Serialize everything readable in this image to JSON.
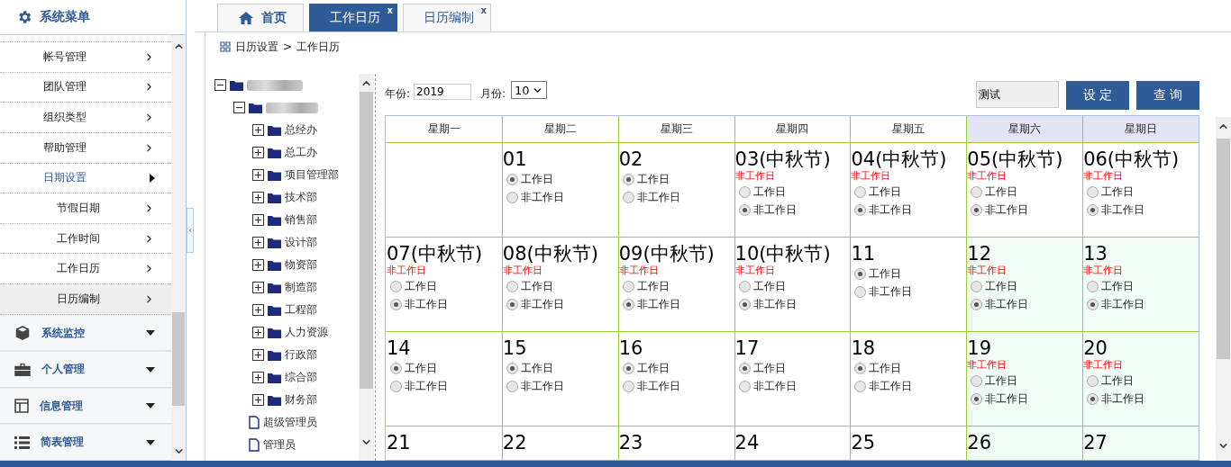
{
  "sidebar": {
    "title": "系统菜单",
    "items": [
      {
        "label": "帐号管理",
        "selected": false
      },
      {
        "label": "团队管理",
        "selected": false
      },
      {
        "label": "组织类型",
        "selected": false
      },
      {
        "label": "帮助管理",
        "selected": false
      },
      {
        "label": "日期设置",
        "selected": false,
        "expanded": true,
        "children": [
          {
            "label": "节假日期",
            "selected": false
          },
          {
            "label": "工作时间",
            "selected": false
          },
          {
            "label": "工作日历",
            "selected": false
          },
          {
            "label": "日历编制",
            "selected": true
          }
        ]
      }
    ],
    "groups": [
      {
        "label": "系统监控",
        "kind": "box",
        "expanded": false
      },
      {
        "label": "个人管理",
        "kind": "briefcase",
        "expanded": false
      },
      {
        "label": "信息管理",
        "kind": "layout",
        "expanded": false
      },
      {
        "label": "简表管理",
        "kind": "list",
        "expanded": false
      }
    ]
  },
  "tabs": [
    {
      "label": "首页",
      "kind": "home",
      "selected": false
    },
    {
      "label": "工作日历",
      "kind": "closable",
      "selected": true,
      "close": "x"
    },
    {
      "label": "日历编制",
      "kind": "closable",
      "selected": false,
      "close": "x"
    }
  ],
  "breadcrumb": {
    "items": [
      "日历设置",
      "工作日历"
    ],
    "separator": ">"
  },
  "tree": {
    "nodes": [
      {
        "kind": "folder",
        "expanded": true,
        "children": [
          {
            "kind": "folder",
            "expanded": true,
            "children": [
              {
                "kind": "folder",
                "label": "总经办",
                "expanded": false
              },
              {
                "kind": "folder",
                "label": "总工办",
                "expanded": false
              },
              {
                "kind": "folder",
                "label": "项目管理部",
                "expanded": false
              },
              {
                "kind": "folder",
                "label": "技术部",
                "expanded": false
              },
              {
                "kind": "folder",
                "label": "销售部",
                "expanded": false
              },
              {
                "kind": "folder",
                "label": "设计部",
                "expanded": false
              },
              {
                "kind": "folder",
                "label": "物资部",
                "expanded": false
              },
              {
                "kind": "folder",
                "label": "制造部",
                "expanded": false
              },
              {
                "kind": "folder",
                "label": "工程部",
                "expanded": false
              },
              {
                "kind": "folder",
                "label": "人力资源",
                "expanded": false
              },
              {
                "kind": "folder",
                "label": "行政部",
                "expanded": false
              },
              {
                "kind": "folder",
                "label": "综合部",
                "expanded": false
              },
              {
                "kind": "folder",
                "label": "财务部",
                "expanded": false
              }
            ]
          },
          {
            "kind": "file",
            "label": "超级管理员"
          },
          {
            "kind": "file",
            "label": "管理员"
          }
        ]
      }
    ]
  },
  "filters": {
    "year_label": "年份:",
    "year": "2019",
    "month_label": "月份:",
    "month": "10"
  },
  "name_field": {
    "value": "测试"
  },
  "buttons": [
    "设 定",
    "查 询"
  ],
  "calendar": {
    "weekdays": [
      {
        "label": "星期一",
        "weekend": false
      },
      {
        "label": "星期二",
        "weekend": false
      },
      {
        "label": "星期三",
        "weekend": false
      },
      {
        "label": "星期四",
        "weekend": false
      },
      {
        "label": "星期五",
        "weekend": false
      },
      {
        "label": "星期六",
        "weekend": true
      },
      {
        "label": "星期日",
        "weekend": true
      }
    ],
    "weeks": [
      [
        {
          "kind": "blank"
        },
        {
          "date": "01",
          "shaded": false,
          "options": [
            {
              "label": "工作日",
              "selected": true
            },
            {
              "label": "非工作日",
              "selected": false
            }
          ]
        },
        {
          "date": "02",
          "shaded": false,
          "options": [
            {
              "label": "工作日",
              "selected": true
            },
            {
              "label": "非工作日",
              "selected": false
            }
          ]
        },
        {
          "date": "03(中秋节)",
          "note": "非工作日",
          "shaded": false,
          "options": [
            {
              "label": "工作日",
              "selected": false
            },
            {
              "label": "非工作日",
              "selected": true
            }
          ]
        },
        {
          "date": "04(中秋节)",
          "note": "非工作日",
          "shaded": false,
          "options": [
            {
              "label": "工作日",
              "selected": false
            },
            {
              "label": "非工作日",
              "selected": true
            }
          ]
        },
        {
          "date": "05(中秋节)",
          "note": "非工作日",
          "shaded": false,
          "options": [
            {
              "label": "工作日",
              "selected": false
            },
            {
              "label": "非工作日",
              "selected": true
            }
          ]
        },
        {
          "date": "06(中秋节)",
          "note": "非工作日",
          "shaded": false,
          "options": [
            {
              "label": "工作日",
              "selected": false
            },
            {
              "label": "非工作日",
              "selected": true
            }
          ]
        }
      ],
      [
        {
          "date": "07(中秋节)",
          "note": "非工作日",
          "shaded": false,
          "options": [
            {
              "label": "工作日",
              "selected": false
            },
            {
              "label": "非工作日",
              "selected": true
            }
          ]
        },
        {
          "date": "08(中秋节)",
          "note": "非工作日",
          "shaded": false,
          "options": [
            {
              "label": "工作日",
              "selected": false
            },
            {
              "label": "非工作日",
              "selected": true
            }
          ]
        },
        {
          "date": "09(中秋节)",
          "note": "非工作日",
          "shaded": false,
          "options": [
            {
              "label": "工作日",
              "selected": false
            },
            {
              "label": "非工作日",
              "selected": true
            }
          ]
        },
        {
          "date": "10(中秋节)",
          "note": "非工作日",
          "shaded": false,
          "options": [
            {
              "label": "工作日",
              "selected": false
            },
            {
              "label": "非工作日",
              "selected": true
            }
          ]
        },
        {
          "date": "11",
          "shaded": false,
          "options": [
            {
              "label": "工作日",
              "selected": true
            },
            {
              "label": "非工作日",
              "selected": false
            }
          ]
        },
        {
          "date": "12",
          "note": "非工作日",
          "shaded": true,
          "options": [
            {
              "label": "工作日",
              "selected": false
            },
            {
              "label": "非工作日",
              "selected": true
            }
          ]
        },
        {
          "date": "13",
          "note": "非工作日",
          "shaded": true,
          "options": [
            {
              "label": "工作日",
              "selected": false
            },
            {
              "label": "非工作日",
              "selected": true
            }
          ]
        }
      ],
      [
        {
          "date": "14",
          "shaded": false,
          "options": [
            {
              "label": "工作日",
              "selected": true
            },
            {
              "label": "非工作日",
              "selected": false
            }
          ]
        },
        {
          "date": "15",
          "shaded": false,
          "options": [
            {
              "label": "工作日",
              "selected": true
            },
            {
              "label": "非工作日",
              "selected": false
            }
          ]
        },
        {
          "date": "16",
          "shaded": false,
          "options": [
            {
              "label": "工作日",
              "selected": true
            },
            {
              "label": "非工作日",
              "selected": false
            }
          ]
        },
        {
          "date": "17",
          "shaded": false,
          "options": [
            {
              "label": "工作日",
              "selected": true
            },
            {
              "label": "非工作日",
              "selected": false
            }
          ]
        },
        {
          "date": "18",
          "shaded": false,
          "options": [
            {
              "label": "工作日",
              "selected": true
            },
            {
              "label": "非工作日",
              "selected": false
            }
          ]
        },
        {
          "date": "19",
          "note": "非工作日",
          "shaded": true,
          "options": [
            {
              "label": "工作日",
              "selected": false
            },
            {
              "label": "非工作日",
              "selected": true
            }
          ]
        },
        {
          "date": "20",
          "note": "非工作日",
          "shaded": true,
          "options": [
            {
              "label": "工作日",
              "selected": false
            },
            {
              "label": "非工作日",
              "selected": true
            }
          ]
        }
      ],
      [
        {
          "date": "21",
          "shaded": false
        },
        {
          "date": "22",
          "shaded": false
        },
        {
          "date": "23",
          "shaded": false
        },
        {
          "date": "24",
          "shaded": false
        },
        {
          "date": "25",
          "shaded": false
        },
        {
          "date": "26",
          "shaded": true
        },
        {
          "date": "27",
          "shaded": true
        }
      ]
    ]
  }
}
